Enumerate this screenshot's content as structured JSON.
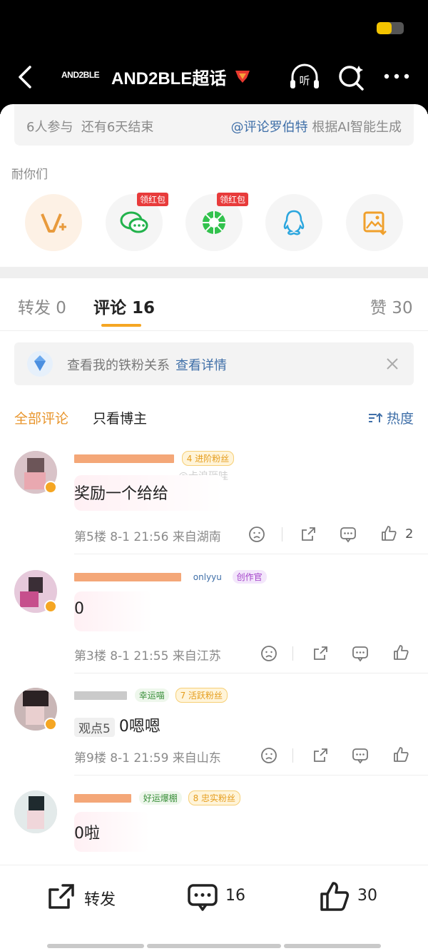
{
  "status": {
    "battery_level": 0.55,
    "battery_color": "#f3c400"
  },
  "header": {
    "brand_logo": "AND2BLE",
    "title": "AND2BLE超话",
    "listen_label": "听"
  },
  "ai_summary": {
    "participants": "6人参与",
    "time_left": "还有6天结束",
    "mention": "@评论罗伯特",
    "suffix": "根据AI智能生成"
  },
  "share": {
    "label": "耐你们",
    "items": [
      {
        "icon": "weibo-v-plus-icon"
      },
      {
        "icon": "wechat-icon",
        "badge": "领红包"
      },
      {
        "icon": "moments-icon",
        "badge": "领红包"
      },
      {
        "icon": "qq-icon"
      },
      {
        "icon": "save-image-icon"
      }
    ]
  },
  "tabs": {
    "repost": "转发 0",
    "comments": "评论 16",
    "likes": "赞 30",
    "accent": "#f5a623"
  },
  "fan_banner": {
    "text": "查看我的铁粉关系",
    "link": "查看详情"
  },
  "filters": {
    "all": "全部评论",
    "author_only": "只看博主",
    "sort": "热度"
  },
  "watermark": "@卡浪砸哇",
  "comments": [
    {
      "tags": [
        {
          "text": "进阶粉丝",
          "level": "4"
        }
      ],
      "text": "奖励一个给给",
      "floor": "第5楼",
      "time": "8-1 21:56",
      "location": "来自湖南",
      "likes": "2"
    },
    {
      "tags": [
        {
          "text": "onlyyu"
        },
        {
          "text": "创作官"
        }
      ],
      "text": "0",
      "floor": "第3楼",
      "time": "8-1 21:55",
      "location": "来自江苏",
      "likes": ""
    },
    {
      "tags": [
        {
          "text": "幸运喵"
        },
        {
          "text": "活跃粉丝",
          "level": "7"
        }
      ],
      "viewpoint": "观点5",
      "text": "0嗯嗯",
      "floor": "第9楼",
      "time": "8-1 21:59",
      "location": "来自山东",
      "likes": ""
    },
    {
      "tags": [
        {
          "text": "好运爆棚"
        },
        {
          "text": "忠实粉丝",
          "level": "8"
        }
      ],
      "text": "0啦"
    }
  ],
  "bottom": {
    "repost": "转发",
    "comments": "16",
    "likes": "30"
  }
}
